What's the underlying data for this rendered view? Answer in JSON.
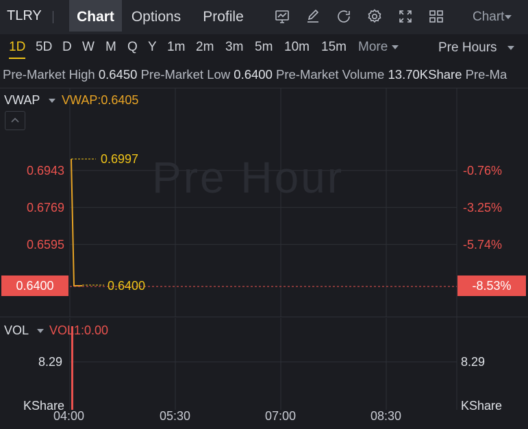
{
  "header": {
    "ticker": "TLRY",
    "tabs": [
      {
        "label": "Chart",
        "active": true
      },
      {
        "label": "Options",
        "active": false
      },
      {
        "label": "Profile",
        "active": false
      }
    ],
    "tool_icons": [
      "chart-type-icon",
      "draw-pen-icon",
      "refresh-icon",
      "settings-gear-icon",
      "fullscreen-icon",
      "grid-layout-icon"
    ],
    "chart_menu": "Chart"
  },
  "intervals": {
    "items": [
      "1D",
      "5D",
      "D",
      "W",
      "M",
      "Q",
      "Y",
      "1m",
      "2m",
      "3m",
      "5m",
      "10m",
      "15m",
      "More"
    ],
    "active": "1D",
    "session": "Pre Hours"
  },
  "stats": [
    {
      "label": "Pre-Market High",
      "value": "0.6450"
    },
    {
      "label": "Pre-Market Low",
      "value": "0.6400"
    },
    {
      "label": "Pre-Market Volume",
      "value": "13.70KShare"
    },
    {
      "label": "Pre-Ma",
      "value": ""
    }
  ],
  "indicator": {
    "name": "VWAP",
    "value_text": "VWAP:0.6405"
  },
  "watermark": "Pre Hour",
  "volume": {
    "name": "VOL",
    "value_text": "VOL1:0.00",
    "tick": "8.29",
    "unit": "KShare"
  },
  "colors": {
    "accent": "#f0c419",
    "down": "#e9524e",
    "vwap": "#e8a425",
    "background": "#1b1c21"
  },
  "chart_data": {
    "type": "line",
    "price_axis_left": [
      "0.6943",
      "0.6769",
      "0.6595",
      "0.6400"
    ],
    "price_axis_right": [
      "-0.76%",
      "-3.25%",
      "-5.74%",
      "-8.53%"
    ],
    "last_price": "0.6400",
    "last_change": "-8.53%",
    "high_marker": "0.6997",
    "low_marker": "0.6400",
    "x_ticks": [
      "04:00",
      "05:30",
      "07:00",
      "08:30"
    ],
    "ylim": [
      0.64,
      0.6997
    ],
    "series": [
      {
        "name": "VWAP",
        "values": [
          0.6997,
          0.64,
          0.64
        ]
      }
    ],
    "volume": {
      "ylim": [
        0,
        8.29
      ],
      "values": [
        8.29
      ]
    },
    "grid": true
  }
}
